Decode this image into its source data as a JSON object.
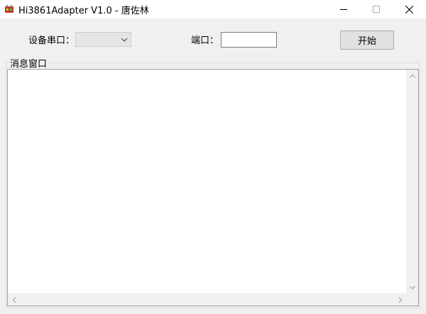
{
  "window": {
    "title": "Hi3861Adapter V1.0 - 唐佐林",
    "icon": "app-icon"
  },
  "toolbar": {
    "device_label": "设备串口：",
    "device_selected": "",
    "port_label": "端口：",
    "port_value": "",
    "start_label": "开始"
  },
  "message_window": {
    "title": "消息窗口",
    "content": ""
  },
  "colors": {
    "window_bg": "#f0f0f0",
    "titlebar_bg": "#ffffff",
    "button_bg": "#e1e1e1",
    "text_area_bg": "#ffffff"
  }
}
